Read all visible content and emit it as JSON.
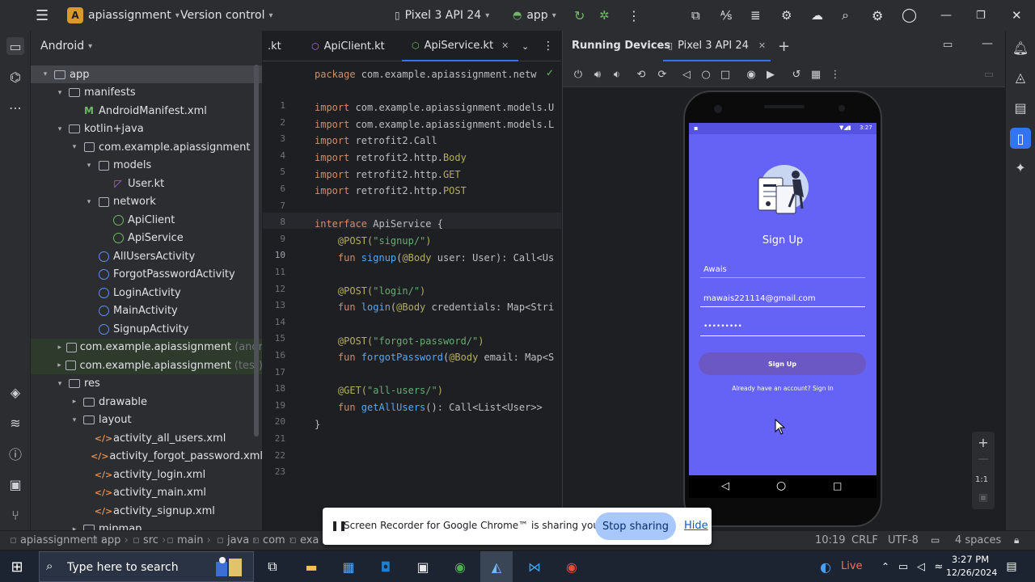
{
  "titlebar": {
    "project_badge": "A",
    "project_name": "apiassignment",
    "vcs": "Version control",
    "device": "Pixel 3 API 24",
    "run_config": "app"
  },
  "project_panel": {
    "header": "Android",
    "tree": [
      {
        "label": "app",
        "depth": 0,
        "arrow": "▾",
        "icon": "folder",
        "sel": true
      },
      {
        "label": "manifests",
        "depth": 1,
        "arrow": "▾",
        "icon": "folder"
      },
      {
        "label": "AndroidManifest.xml",
        "depth": 2,
        "arrow": "",
        "icon": "manifest"
      },
      {
        "label": "kotlin+java",
        "depth": 1,
        "arrow": "▾",
        "icon": "folder"
      },
      {
        "label": "com.example.apiassignment",
        "depth": 2,
        "arrow": "▾",
        "icon": "pkg"
      },
      {
        "label": "models",
        "depth": 3,
        "arrow": "▾",
        "icon": "pkg"
      },
      {
        "label": "User.kt",
        "depth": 4,
        "arrow": "",
        "icon": "kt"
      },
      {
        "label": "network",
        "depth": 3,
        "arrow": "▾",
        "icon": "pkg"
      },
      {
        "label": "ApiClient",
        "depth": 4,
        "arrow": "",
        "icon": "cls-green"
      },
      {
        "label": "ApiService",
        "depth": 4,
        "arrow": "",
        "icon": "cls-green"
      },
      {
        "label": "AllUsersActivity",
        "depth": 3,
        "arrow": "",
        "icon": "cls"
      },
      {
        "label": "ForgotPasswordActivity",
        "depth": 3,
        "arrow": "",
        "icon": "cls"
      },
      {
        "label": "LoginActivity",
        "depth": 3,
        "arrow": "",
        "icon": "cls"
      },
      {
        "label": "MainActivity",
        "depth": 3,
        "arrow": "",
        "icon": "cls"
      },
      {
        "label": "SignupActivity",
        "depth": 3,
        "arrow": "",
        "icon": "cls"
      },
      {
        "label": "com.example.apiassignment",
        "suffix": "(andr",
        "depth": 2,
        "arrow": "▸",
        "icon": "pkg",
        "green": true
      },
      {
        "label": "com.example.apiassignment",
        "suffix": "(test)",
        "depth": 2,
        "arrow": "▸",
        "icon": "pkg",
        "green": true
      },
      {
        "label": "res",
        "depth": 1,
        "arrow": "▾",
        "icon": "folder"
      },
      {
        "label": "drawable",
        "depth": 2,
        "arrow": "▸",
        "icon": "folder"
      },
      {
        "label": "layout",
        "depth": 2,
        "arrow": "▾",
        "icon": "folder"
      },
      {
        "label": "activity_all_users.xml",
        "depth": 3,
        "arrow": "",
        "icon": "xml"
      },
      {
        "label": "activity_forgot_password.xml",
        "depth": 3,
        "arrow": "",
        "icon": "xml"
      },
      {
        "label": "activity_login.xml",
        "depth": 3,
        "arrow": "",
        "icon": "xml"
      },
      {
        "label": "activity_main.xml",
        "depth": 3,
        "arrow": "",
        "icon": "xml"
      },
      {
        "label": "activity_signup.xml",
        "depth": 3,
        "arrow": "",
        "icon": "xml"
      },
      {
        "label": "mipmap",
        "depth": 2,
        "arrow": "▸",
        "icon": "folder"
      }
    ]
  },
  "editor": {
    "tabs": [
      ".kt",
      "ApiClient.kt",
      "ApiService.kt"
    ],
    "current_line": "10",
    "lines": [
      [
        {
          "t": "package ",
          "c": "kw"
        },
        {
          "t": "com.example.apiassignment.netw",
          "c": ""
        }
      ],
      [],
      [
        {
          "t": "import ",
          "c": "kw"
        },
        {
          "t": "com.example.apiassignment.models.U",
          "c": ""
        }
      ],
      [
        {
          "t": "import ",
          "c": "kw"
        },
        {
          "t": "com.example.apiassignment.models.L",
          "c": ""
        }
      ],
      [
        {
          "t": "import ",
          "c": "kw"
        },
        {
          "t": "retrofit2.Call",
          "c": ""
        }
      ],
      [
        {
          "t": "import ",
          "c": "kw"
        },
        {
          "t": "retrofit2.http.",
          "c": ""
        },
        {
          "t": "Body",
          "c": "ann"
        }
      ],
      [
        {
          "t": "import ",
          "c": "kw"
        },
        {
          "t": "retrofit2.http.",
          "c": ""
        },
        {
          "t": "GET",
          "c": "ann"
        }
      ],
      [
        {
          "t": "import ",
          "c": "kw"
        },
        {
          "t": "retrofit2.http.",
          "c": ""
        },
        {
          "t": "POST",
          "c": "ann"
        }
      ],
      [],
      [
        {
          "t": "interface ",
          "c": "kw"
        },
        {
          "t": "ApiService",
          "c": ""
        },
        {
          "t": " {",
          "c": ""
        }
      ],
      [
        {
          "t": "    @POST(",
          "c": "ann"
        },
        {
          "t": "\"signup/\"",
          "c": "str"
        },
        {
          "t": ")",
          "c": "ann"
        }
      ],
      [
        {
          "t": "    fun ",
          "c": "kw"
        },
        {
          "t": "signup",
          "c": "fn"
        },
        {
          "t": "(",
          "c": ""
        },
        {
          "t": "@Body",
          "c": "ann"
        },
        {
          "t": " user: User): Call<Us",
          "c": ""
        }
      ],
      [],
      [
        {
          "t": "    @POST(",
          "c": "ann"
        },
        {
          "t": "\"login/\"",
          "c": "str"
        },
        {
          "t": ")",
          "c": "ann"
        }
      ],
      [
        {
          "t": "    fun ",
          "c": "kw"
        },
        {
          "t": "login",
          "c": "fn"
        },
        {
          "t": "(",
          "c": ""
        },
        {
          "t": "@Body",
          "c": "ann"
        },
        {
          "t": " credentials: Map<Stri",
          "c": ""
        }
      ],
      [],
      [
        {
          "t": "    @POST(",
          "c": "ann"
        },
        {
          "t": "\"forgot-password/\"",
          "c": "str"
        },
        {
          "t": ")",
          "c": "ann"
        }
      ],
      [
        {
          "t": "    fun ",
          "c": "kw"
        },
        {
          "t": "forgotPassword",
          "c": "fn"
        },
        {
          "t": "(",
          "c": ""
        },
        {
          "t": "@Body",
          "c": "ann"
        },
        {
          "t": " email: Map<S",
          "c": ""
        }
      ],
      [],
      [
        {
          "t": "    @GET(",
          "c": "ann"
        },
        {
          "t": "\"all-users/\"",
          "c": "str"
        },
        {
          "t": ")",
          "c": "ann"
        }
      ],
      [
        {
          "t": "    fun ",
          "c": "kw"
        },
        {
          "t": "getAllUsers",
          "c": "fn"
        },
        {
          "t": "(): Call<List<User>>",
          "c": ""
        }
      ],
      [
        {
          "t": "}",
          "c": ""
        }
      ],
      []
    ]
  },
  "devices": {
    "panel_title": "Running Devices",
    "device_tab": "Pixel 3 API 24",
    "zoom_ratio": "1:1"
  },
  "phone": {
    "status_time": "3:27",
    "screen_title": "Sign Up",
    "name_value": "Awais",
    "email_value": "mawais221114@gmail.com",
    "password_value": "•••••••••",
    "signup_button": "Sign Up",
    "signin_link": "Already have an account? Sign In"
  },
  "statusbar": {
    "breadcrumbs": [
      "apiassignment",
      "app",
      "src",
      "main",
      "java",
      "com",
      "exa"
    ],
    "position": "10:19",
    "line_sep": "CRLF",
    "encoding": "UTF-8",
    "indent": "4 spaces"
  },
  "share_banner": {
    "message": "Screen Recorder for Google Chrome™ is sharing your screen.",
    "stop_label": "Stop sharing",
    "hide_label": "Hide"
  },
  "taskbar": {
    "search_placeholder": "Type here to search",
    "weather": "Live",
    "time": "3:27 PM",
    "date": "12/26/2024"
  },
  "colors": {
    "accent": "#3574f0",
    "phone_bg": "#6563f5",
    "button": "#6b58c4"
  }
}
